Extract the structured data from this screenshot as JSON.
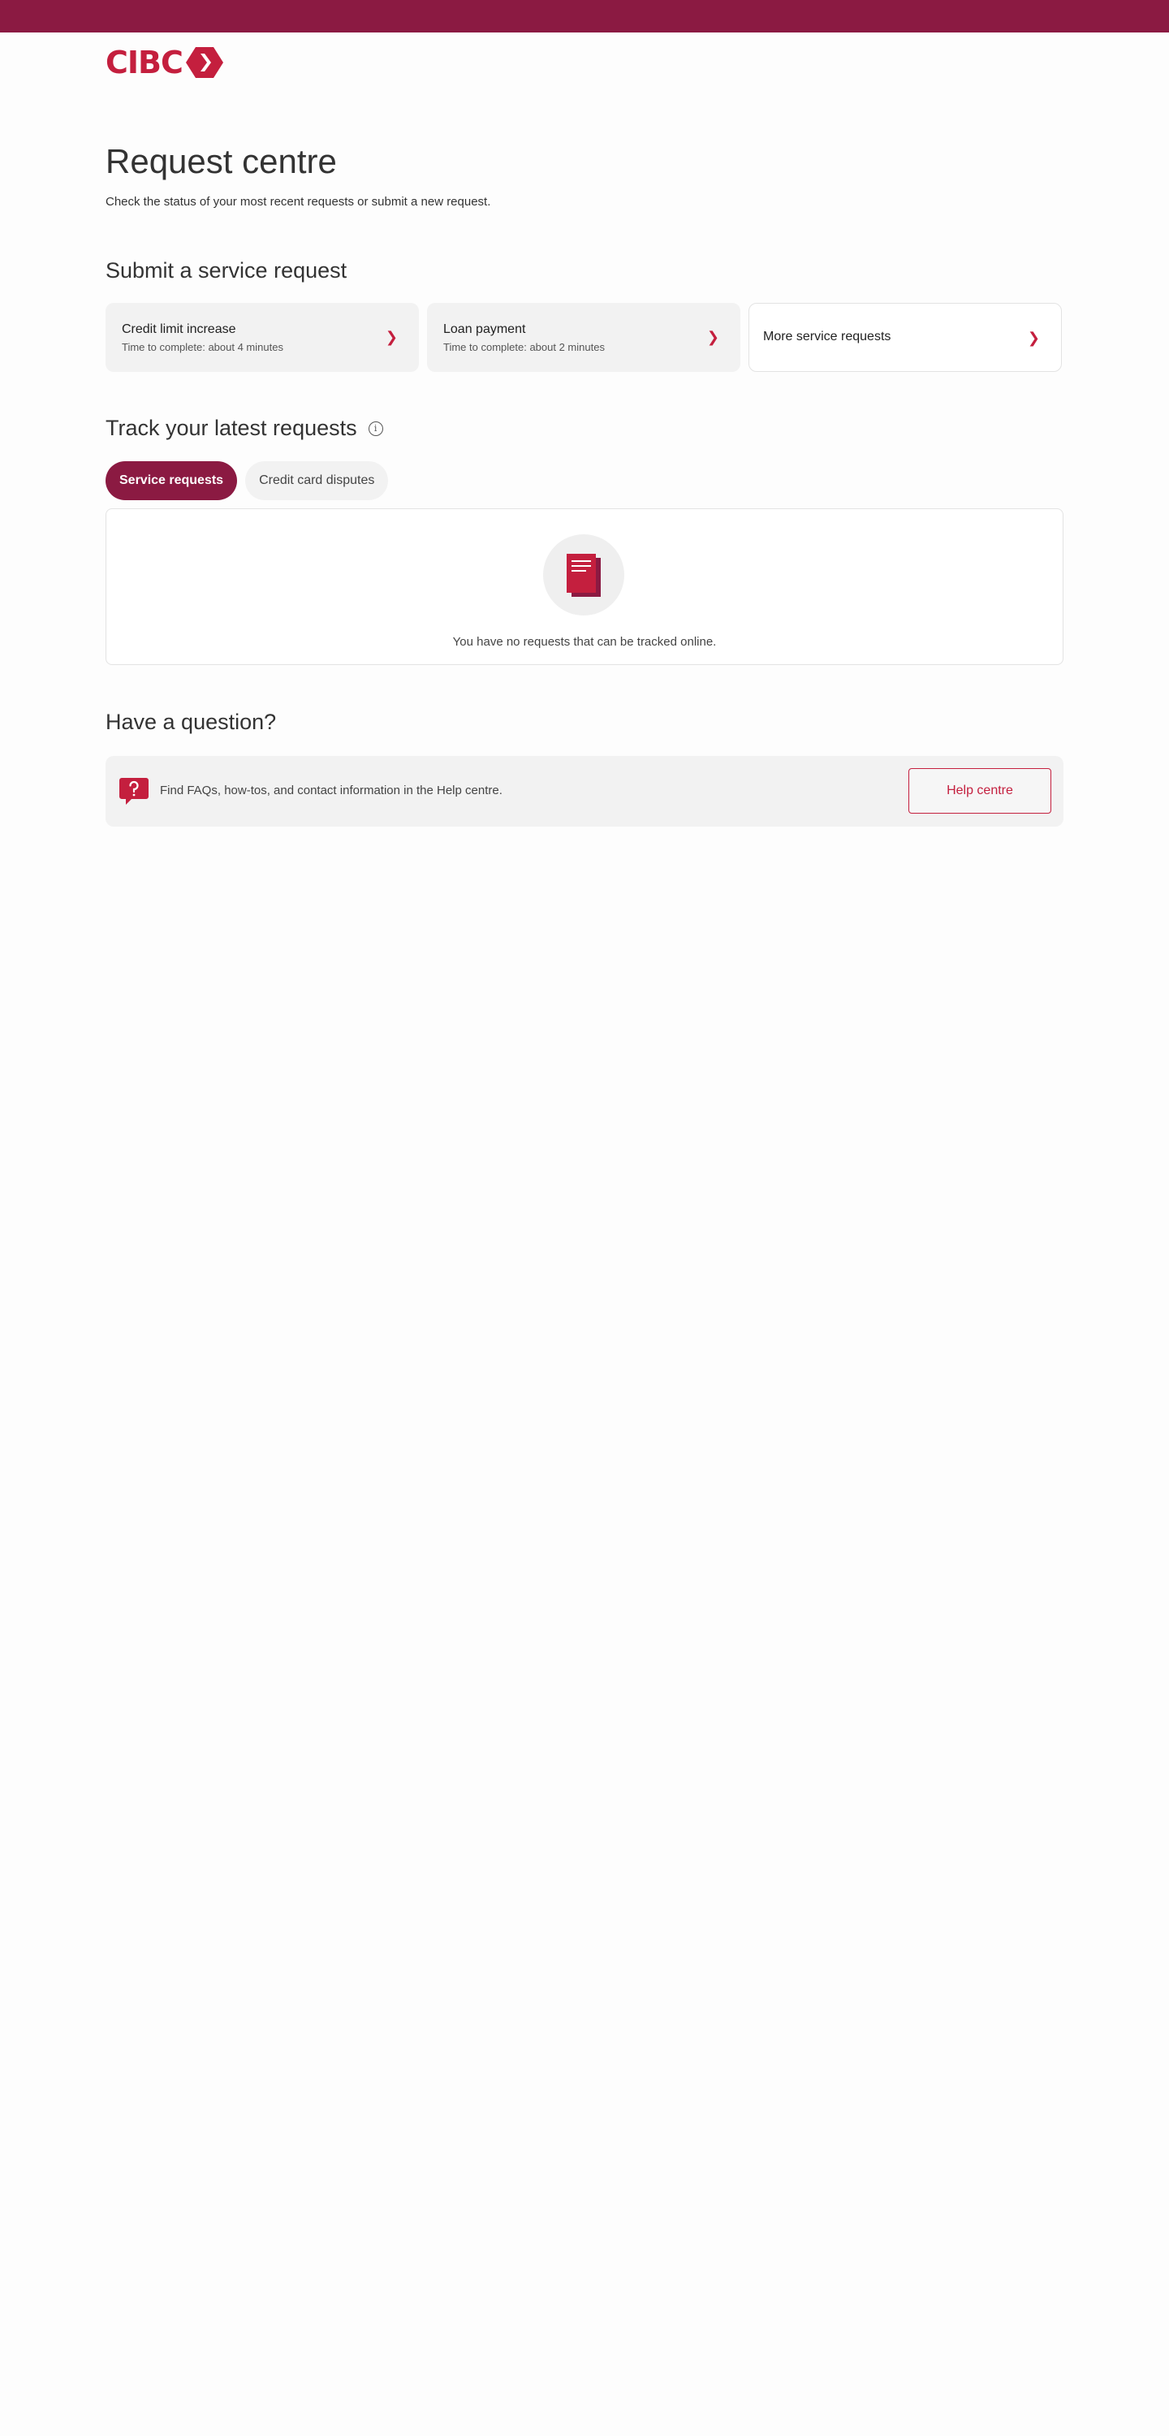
{
  "brand": {
    "logo_text": "CIBC",
    "color": "#c41f3e",
    "bar_color": "#8b1a42"
  },
  "page": {
    "title": "Request centre",
    "subtitle": "Check the status of your most recent requests or submit a new request."
  },
  "submit": {
    "title": "Submit a service request",
    "cards": [
      {
        "title": "Credit limit increase",
        "subtitle": "Time to complete: about 4 minutes",
        "icon": "chevron-right-icon"
      },
      {
        "title": "Loan payment",
        "subtitle": "Time to complete: about 2 minutes",
        "icon": "chevron-right-icon"
      },
      {
        "title": "More service requests",
        "icon": "chevron-right-icon"
      }
    ],
    "chevron": "❯"
  },
  "track": {
    "title": "Track your latest requests",
    "info_glyph": "i",
    "tabs": [
      {
        "label": "Service requests",
        "active": true
      },
      {
        "label": "Credit card disputes",
        "active": false
      }
    ],
    "empty_message": "You have no requests that can be tracked online.",
    "empty_icon": "documents-icon"
  },
  "question": {
    "title": "Have a question?",
    "text": "Find FAQs, how-tos, and contact information in the Help centre.",
    "button": "Help centre",
    "icon": "question-bubble-icon"
  }
}
